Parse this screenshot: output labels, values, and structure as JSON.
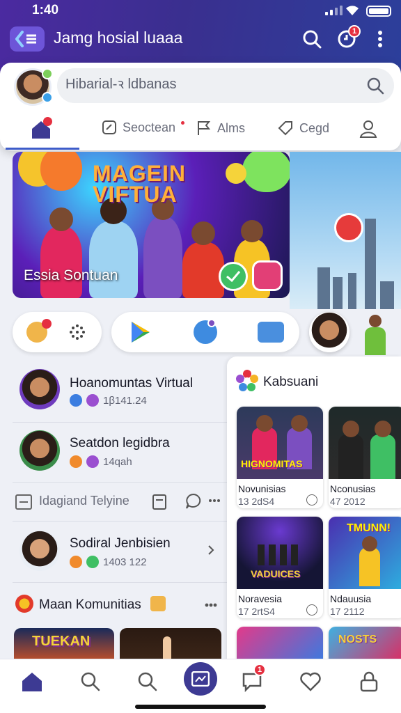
{
  "status": {
    "time": "1:40"
  },
  "header": {
    "title": "Jamg hosial luaaa",
    "notif_badge": "1"
  },
  "search": {
    "placeholder": "Hibarial-ꝛ ldbanas"
  },
  "tabs": [
    {
      "label": ""
    },
    {
      "label": "Seoctean"
    },
    {
      "label": "Alms"
    },
    {
      "label": "Cegd"
    },
    {
      "label": ""
    }
  ],
  "hero": {
    "title_line1": "MAGEIN",
    "title_line2": "VIFTUA",
    "subtitle": "Essia Sontuan"
  },
  "feed": [
    {
      "name": "Hoanomuntas Virtual",
      "meta": "1β141.24"
    },
    {
      "name": "Seatdon legidbra",
      "meta": "14qah"
    },
    {
      "name": "Sodiral Jenbisien",
      "meta": "1403 122"
    }
  ],
  "action_row": {
    "label": "Idagiand Telyine"
  },
  "section": {
    "title": "Maan Komunitias"
  },
  "right_panel": {
    "title": "Kabsuani",
    "tiles": [
      {
        "image_text": "HIGNOMITAS",
        "title": "Novunisias",
        "meta": "13 2dS4"
      },
      {
        "image_text": "",
        "title": "Nconusias",
        "meta": "47 2012"
      },
      {
        "image_text": "VADUICES",
        "title": "Noravesia",
        "meta": "17 2rtS4"
      },
      {
        "image_text": "TMUNN!",
        "title": "Ndauusia",
        "meta": "17 2112"
      }
    ]
  },
  "bottom_tile_text": "TUEKAN",
  "bottom_tile2_text": "NOSTS",
  "bottom_nav": {
    "msg_badge": "1"
  },
  "colors": {
    "header_bg": "#3a2f8f",
    "accent": "#3d5cc9",
    "badge": "#e53040"
  }
}
